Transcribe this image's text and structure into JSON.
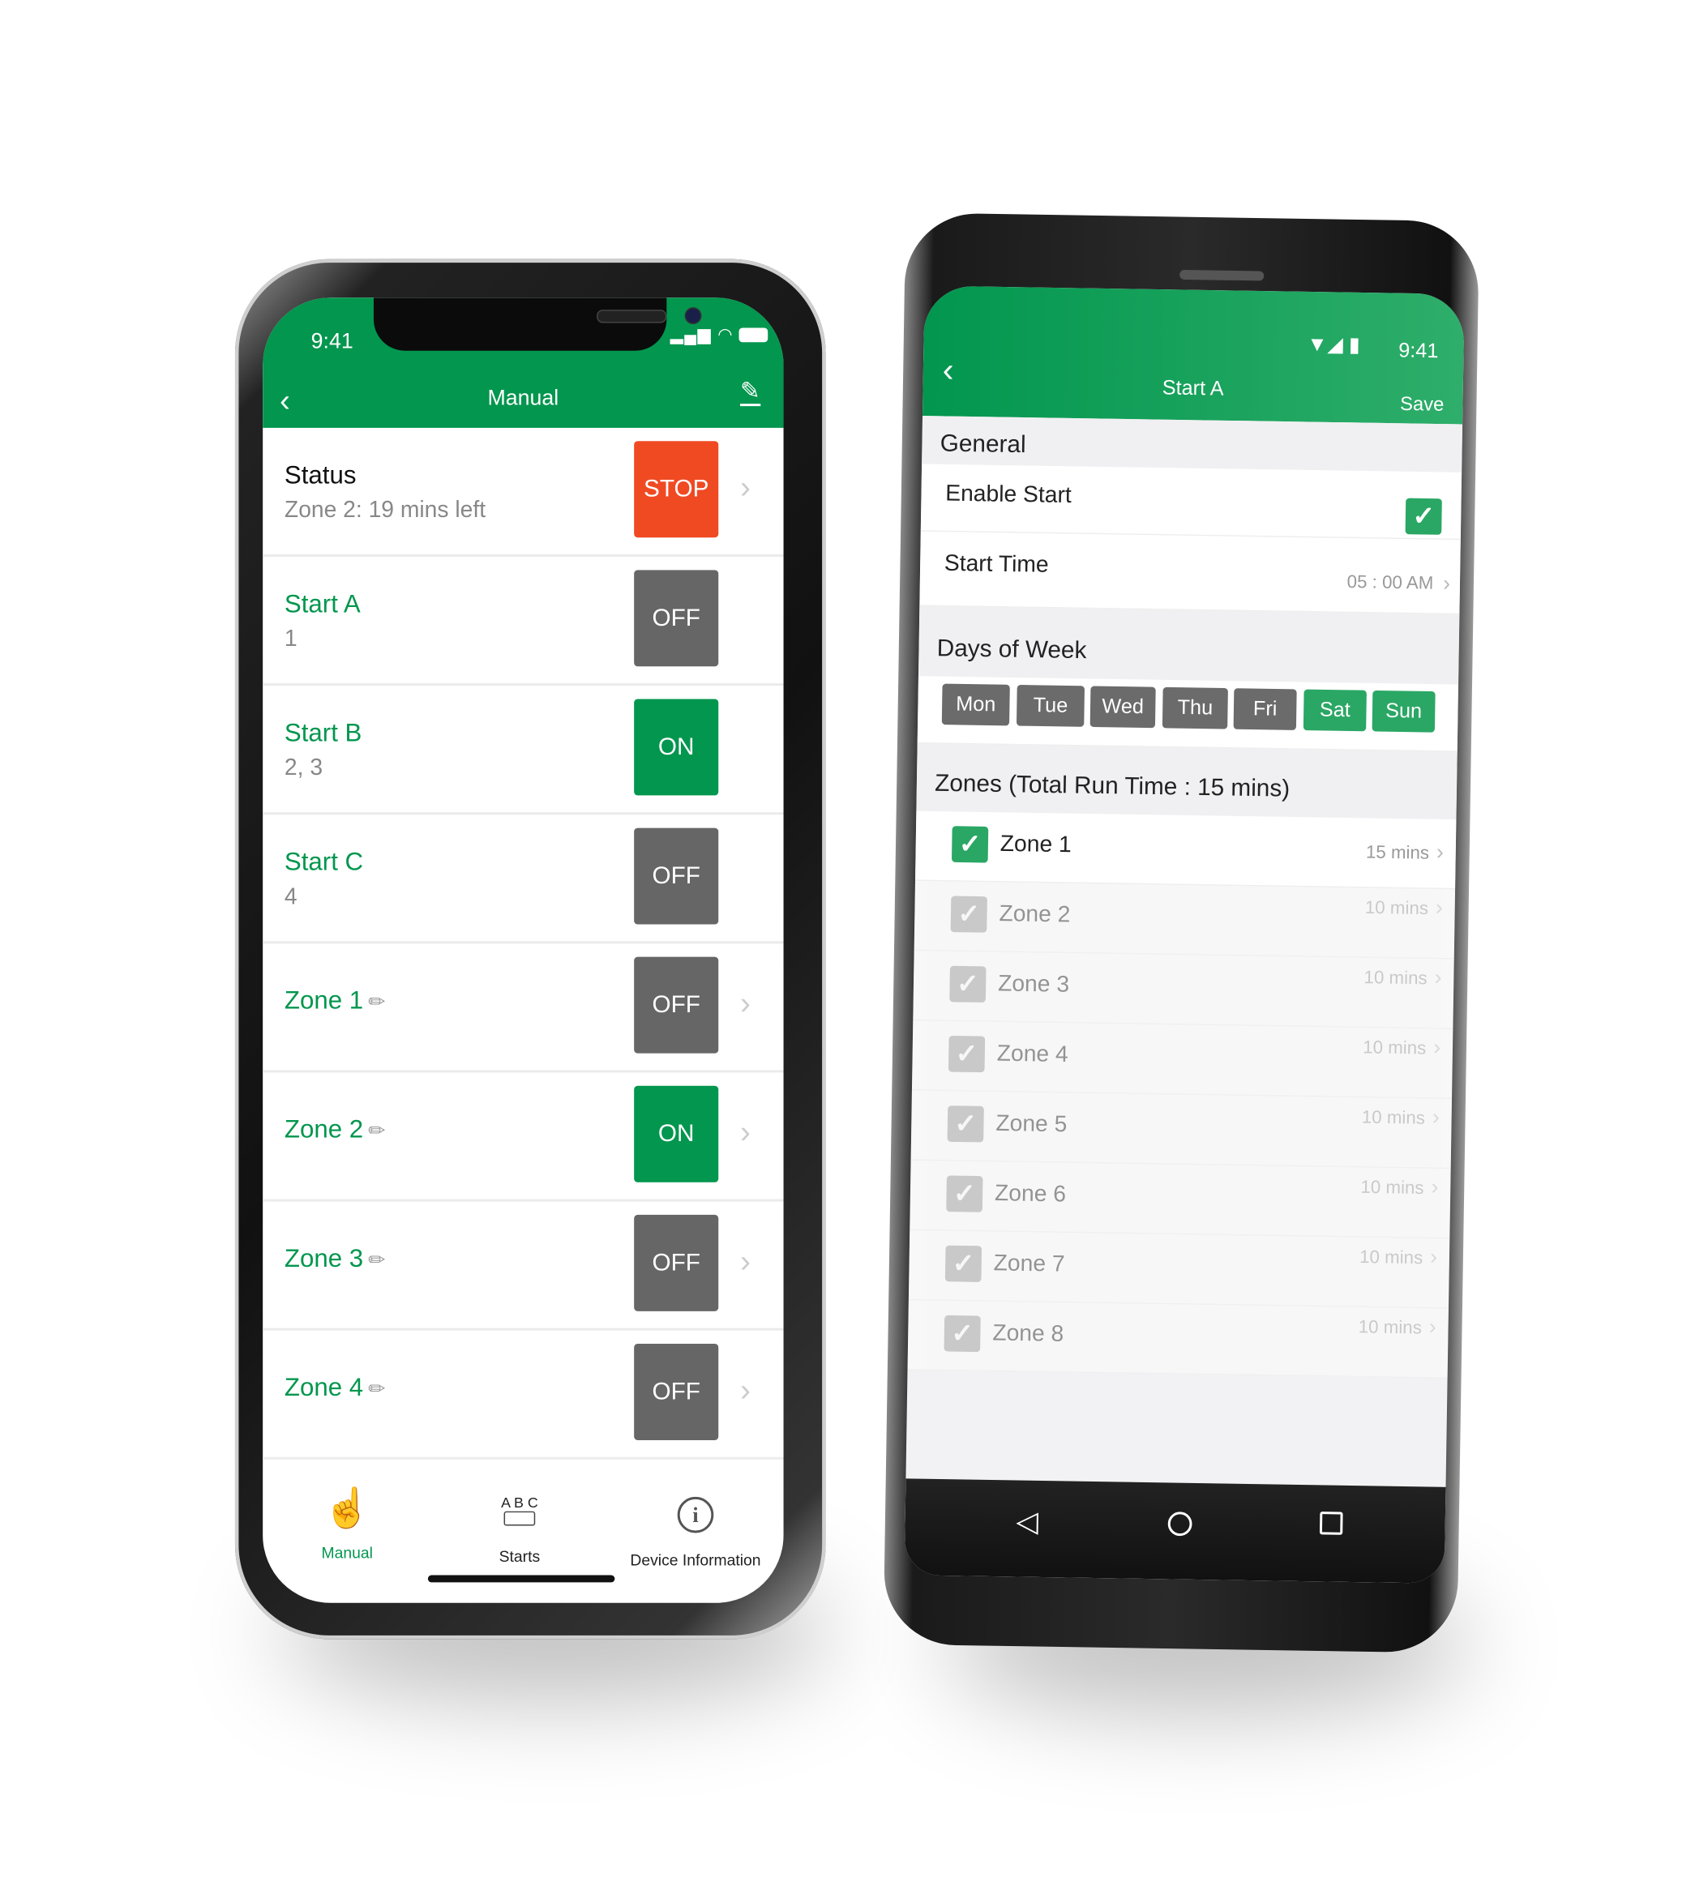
{
  "colors": {
    "brand_green": "#02964e",
    "stop_red": "#f04a23",
    "off_gray": "#666666",
    "day_inactive": "#6b6b6b",
    "day_active": "#2aa764"
  },
  "ios": {
    "status_time": "9:41",
    "header": {
      "title": "Manual",
      "back_icon": "chevron-left-icon",
      "edit_icon": "pencil-icon"
    },
    "rows": [
      {
        "title": "Status",
        "subtitle": "Zone 2:  19 mins left",
        "button": "STOP",
        "state": "stop",
        "chevron": true,
        "editable": false
      },
      {
        "title": "Start A",
        "subtitle": "1",
        "button": "OFF",
        "state": "off",
        "chevron": false,
        "editable": false
      },
      {
        "title": "Start B",
        "subtitle": "2, 3",
        "button": "ON",
        "state": "on",
        "chevron": false,
        "editable": false
      },
      {
        "title": "Start C",
        "subtitle": "4",
        "button": "OFF",
        "state": "off",
        "chevron": false,
        "editable": false
      },
      {
        "title": "Zone 1",
        "subtitle": "",
        "button": "OFF",
        "state": "off",
        "chevron": true,
        "editable": true
      },
      {
        "title": "Zone 2",
        "subtitle": "",
        "button": "ON",
        "state": "on",
        "chevron": true,
        "editable": true
      },
      {
        "title": "Zone 3",
        "subtitle": "",
        "button": "OFF",
        "state": "off",
        "chevron": true,
        "editable": true
      },
      {
        "title": "Zone 4",
        "subtitle": "",
        "button": "OFF",
        "state": "off",
        "chevron": true,
        "editable": true
      }
    ],
    "tabs": [
      {
        "label": "Manual",
        "icon": "hand-pointer-icon",
        "active": true
      },
      {
        "label": "Starts",
        "icon": "abc-toggle-icon",
        "active": false,
        "icon_text": "A B C"
      },
      {
        "label": "Device Information",
        "icon": "info-icon",
        "active": false
      }
    ]
  },
  "android": {
    "status_time": "9:41",
    "header": {
      "title": "Start A",
      "save": "Save",
      "back_icon": "chevron-left-icon"
    },
    "general": {
      "section": "General",
      "enable_label": "Enable Start",
      "enable_checked": true,
      "start_time_label": "Start Time",
      "start_time_value": "05 : 00 AM"
    },
    "days": {
      "section": "Days of Week",
      "items": [
        {
          "label": "Mon",
          "active": false
        },
        {
          "label": "Tue",
          "active": false
        },
        {
          "label": "Wed",
          "active": false
        },
        {
          "label": "Thu",
          "active": false
        },
        {
          "label": "Fri",
          "active": false
        },
        {
          "label": "Sat",
          "active": true
        },
        {
          "label": "Sun",
          "active": true
        }
      ]
    },
    "zones": {
      "section": "Zones (Total Run Time :  15 mins)",
      "items": [
        {
          "label": "Zone 1",
          "time": "15 mins",
          "enabled": true
        },
        {
          "label": "Zone 2",
          "time": "10 mins",
          "enabled": false
        },
        {
          "label": "Zone 3",
          "time": "10 mins",
          "enabled": false
        },
        {
          "label": "Zone 4",
          "time": "10 mins",
          "enabled": false
        },
        {
          "label": "Zone 5",
          "time": "10 mins",
          "enabled": false
        },
        {
          "label": "Zone 6",
          "time": "10 mins",
          "enabled": false
        },
        {
          "label": "Zone 7",
          "time": "10 mins",
          "enabled": false
        },
        {
          "label": "Zone 8",
          "time": "10 mins",
          "enabled": false
        }
      ]
    }
  }
}
